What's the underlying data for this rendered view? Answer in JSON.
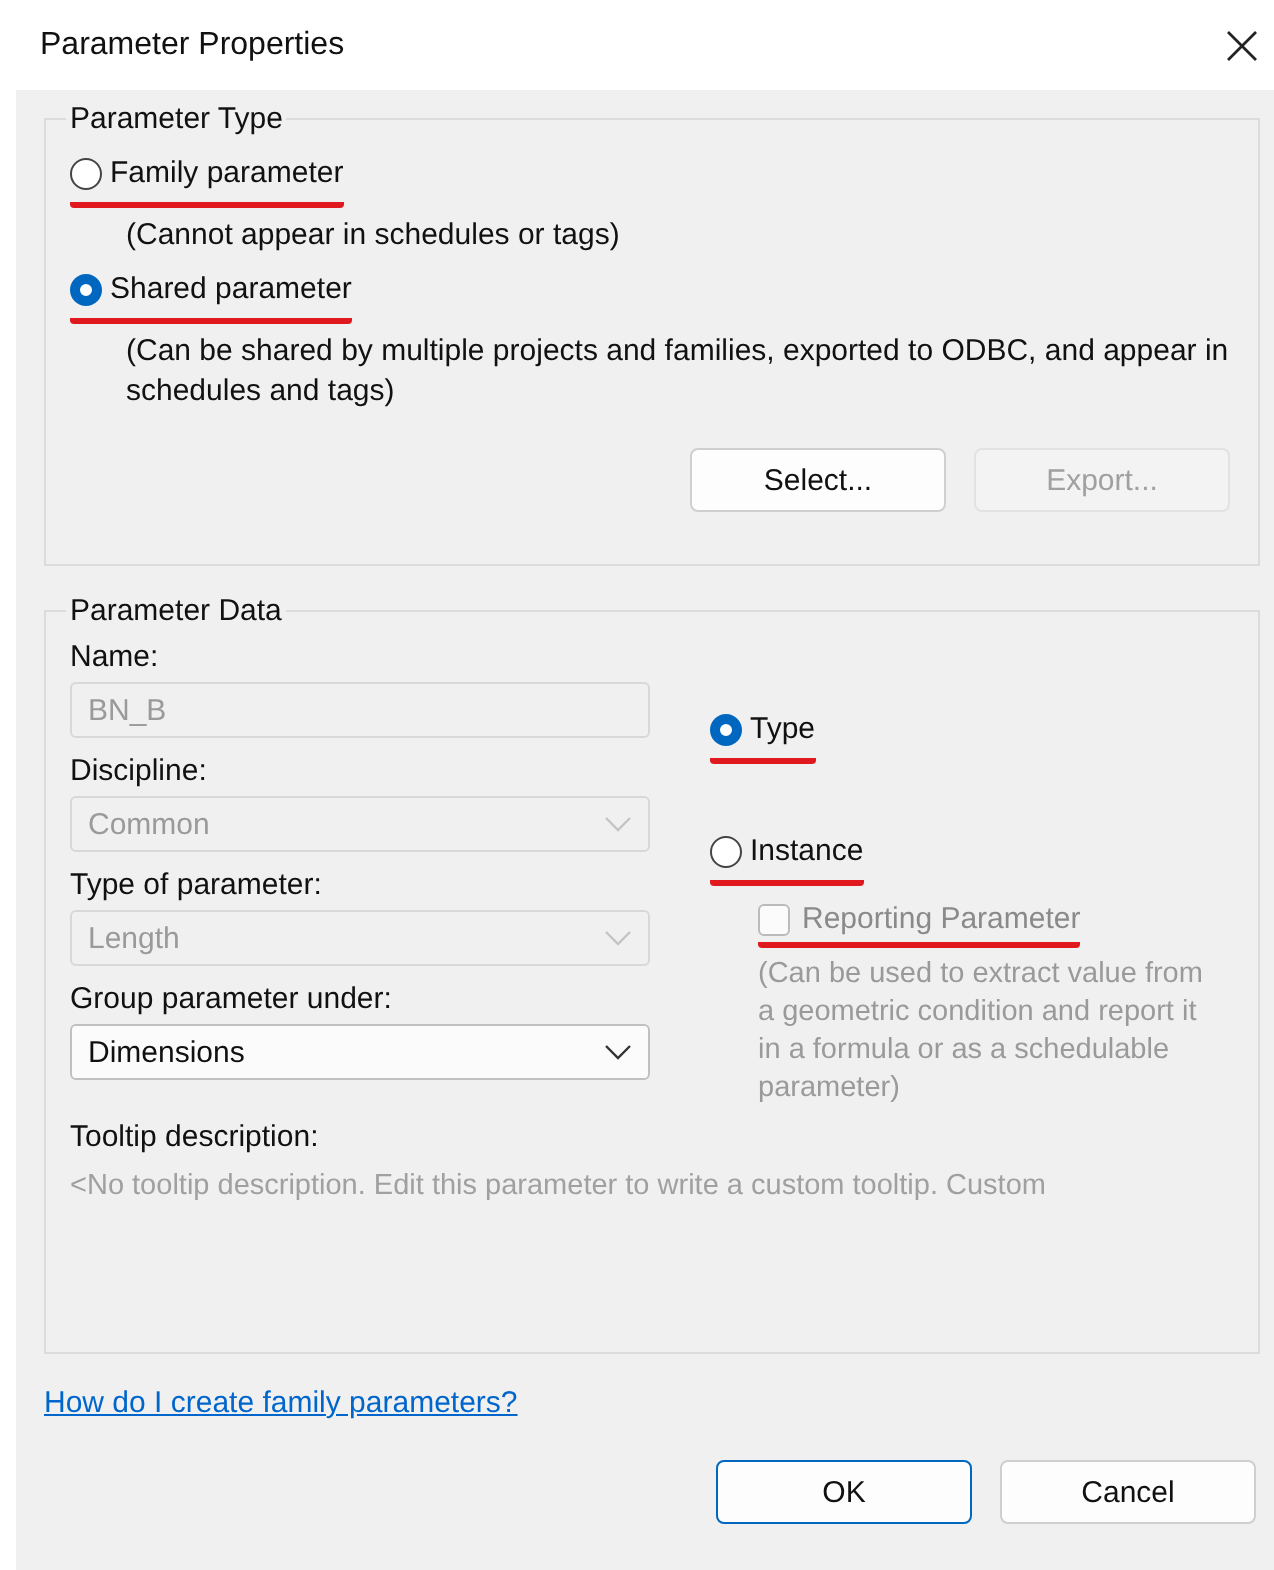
{
  "window": {
    "title": "Parameter Properties"
  },
  "parameter_type": {
    "legend": "Parameter Type",
    "options": [
      {
        "label": "Family parameter",
        "selected": false,
        "underlined": true,
        "note": "(Cannot appear in schedules or tags)"
      },
      {
        "label": "Shared parameter",
        "selected": true,
        "underlined": true,
        "note": "(Can be shared by multiple projects and families, exported to ODBC, and appear in schedules and tags)"
      }
    ],
    "buttons": [
      {
        "label": "Select...",
        "disabled": false
      },
      {
        "label": "Export...",
        "disabled": true
      }
    ]
  },
  "parameter_data": {
    "legend": "Parameter Data",
    "fields": [
      {
        "label": "Name:",
        "kind": "text",
        "value": "BN_B",
        "disabled": true
      },
      {
        "label": "Discipline:",
        "kind": "dropdown",
        "value": "Common",
        "disabled": true
      },
      {
        "label": "Type of parameter:",
        "kind": "dropdown",
        "value": "Length",
        "disabled": true
      },
      {
        "label": "Group parameter under:",
        "kind": "dropdown",
        "value": "Dimensions",
        "disabled": false
      }
    ],
    "options": [
      {
        "label": "Type",
        "selected": true,
        "underlined": true
      },
      {
        "label": "Instance",
        "selected": false,
        "underlined": true
      }
    ],
    "reporting": {
      "label": "Reporting Parameter",
      "checked": false,
      "disabled": true,
      "underlined": true,
      "note": "(Can be used to extract value from a geometric condition and report it in a formula or as a schedulable parameter)"
    },
    "tooltip": {
      "label": "Tooltip description:",
      "text": "<No tooltip description. Edit this parameter to write a custom tooltip. Custom"
    }
  },
  "help_link": "How do I create family parameters?",
  "buttons": [
    {
      "label": "OK",
      "default": true
    },
    {
      "label": "Cancel",
      "default": false
    }
  ]
}
